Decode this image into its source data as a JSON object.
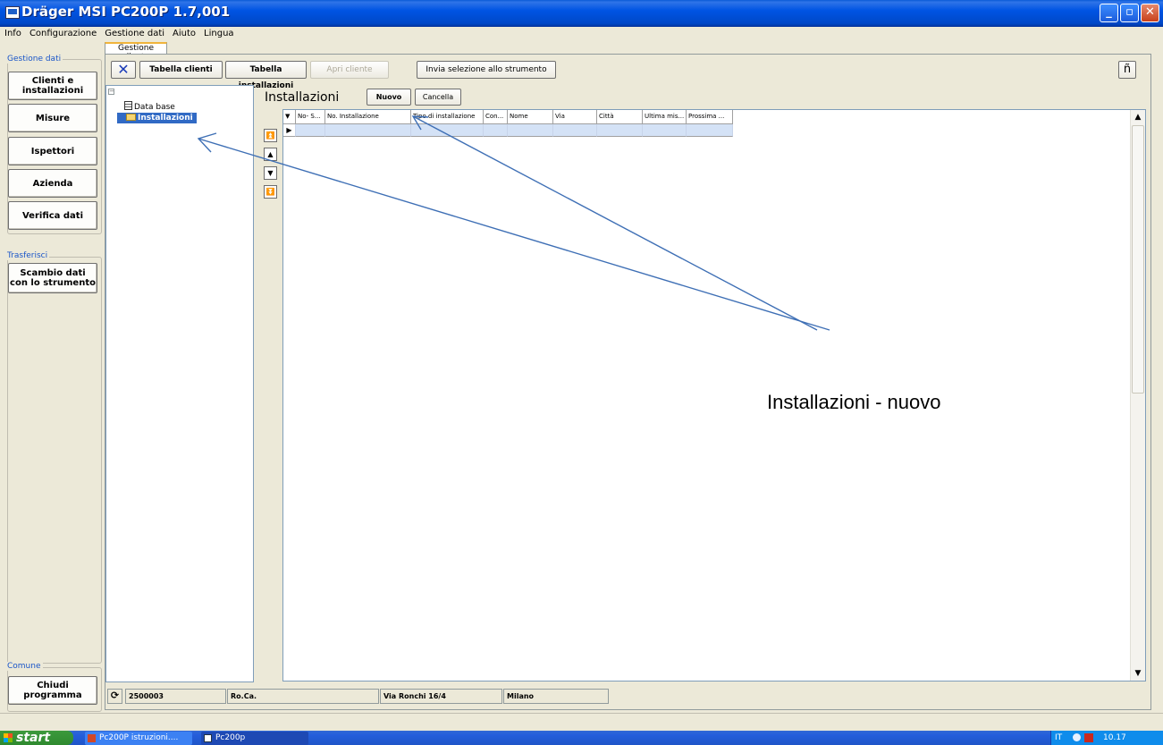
{
  "window": {
    "title": "Dräger MSI PC200P 1.7,001",
    "btn_min": "_",
    "btn_max": "▫",
    "btn_close": "✕"
  },
  "menu": [
    "Info",
    "Configurazione",
    "Gestione dati",
    "Aiuto",
    "Lingua"
  ],
  "nav": {
    "group_data_label": "Gestione dati",
    "buttons": [
      "Clienti e\ninstallazioni",
      "Misure",
      "Ispettori",
      "Azienda",
      "Verifica dati"
    ],
    "group_transfer_label": "Trasferisci",
    "transfer_button": "Scambio dati\ncon lo strumento",
    "group_common_label": "Comune",
    "exit_button": "Chiudi programma"
  },
  "tab": {
    "label": "Gestione cliente"
  },
  "toolbar": {
    "close_glyph": "✕",
    "clients_table": "Tabella clienti",
    "installations_table": "Tabella installazioni",
    "open_client": "Apri cliente",
    "send_selection": "Invia selezione allo strumento",
    "info_glyph": "ñ"
  },
  "tree": {
    "collapse": "−",
    "root": "Data base",
    "child": "Installazioni"
  },
  "installazioni": {
    "title": "Installazioni",
    "new_button": "Nuovo",
    "delete_button": "Cancella",
    "columns": [
      "▼",
      "No- S...",
      "No. Installazione",
      "Tipo di installazione",
      "Con...",
      "Nome",
      "Via",
      "Città",
      "Ultima mis...",
      "Prossima ..."
    ],
    "row_marker": "▶"
  },
  "record_nav": [
    "⏫",
    "▲",
    "▼",
    "⏬"
  ],
  "status": {
    "refresh_glyph": "⟳",
    "client_id": "2500003",
    "client_name": "Ro.Ca.",
    "address": "Via Ronchi 16/4",
    "city": "Milano"
  },
  "annotation": "Installazioni - nuovo",
  "taskbar": {
    "start": "start",
    "items": [
      "Pc200P istruzioni....",
      "Pc200p"
    ],
    "language": "IT",
    "clock": "10.17"
  }
}
